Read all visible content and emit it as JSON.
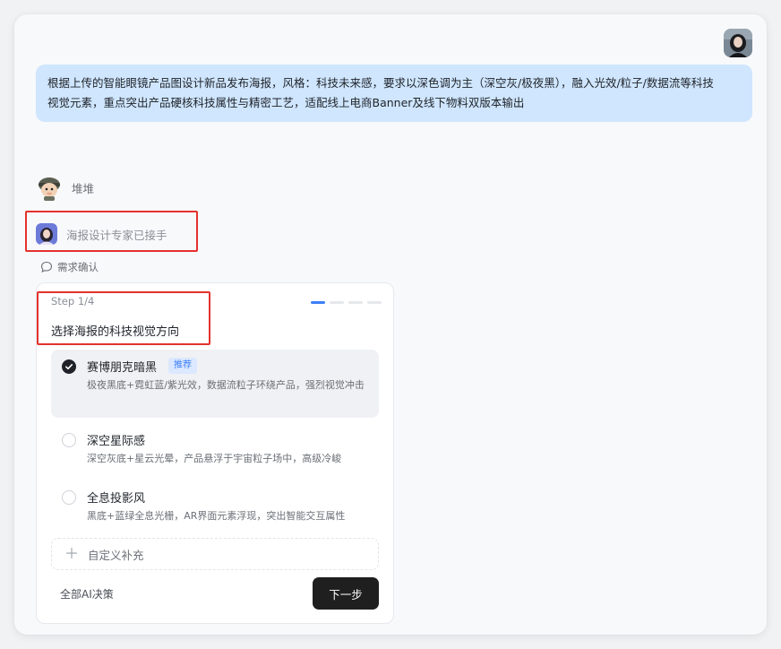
{
  "user_message": {
    "line1": "根据上传的智能眼镜产品图设计新品发布海报，风格：科技未来感，要求以深色调为主（深空灰/极夜黑），融入光效/粒子/数据流等科技",
    "line2": "视觉元素，重点突出产品硬核科技属性与精密工艺，适配线上电商Banner及线下物料双版本输出"
  },
  "bot": {
    "name": "堆堆"
  },
  "handoff": {
    "text": "海报设计专家已接手"
  },
  "requirement": {
    "label": "需求确认"
  },
  "card": {
    "step": "Step 1/4",
    "progress_current": 1,
    "progress_total": 4,
    "title": "选择海报的科技视觉方向",
    "options": [
      {
        "name": "赛博朋克暗黑",
        "badge": "推荐",
        "desc": "极夜黑底+霓虹蓝/紫光效，数据流粒子环绕产品，强烈视觉冲击",
        "selected": true
      },
      {
        "name": "深空星际感",
        "desc": "深空灰底+星云光晕，产品悬浮于宇宙粒子场中，高级冷峻",
        "selected": false
      },
      {
        "name": "全息投影风",
        "desc": "黑底+蓝绿全息光栅，AR界面元素浮现，突出智能交互属性",
        "selected": false
      }
    ],
    "custom_label": "自定义补充",
    "ai_decide": "全部AI决策",
    "next": "下一步"
  },
  "icons": {
    "user_avatar": "user-avatar",
    "bot_avatar": "bot-avatar",
    "expert_avatar": "expert-avatar",
    "chat": "chat-bubble-icon",
    "check": "check-icon",
    "plus": "plus-icon"
  },
  "colors": {
    "user_bubble": "#cfe6fe",
    "accent": "#3d7ff6",
    "highlight": "#e5322d",
    "primary_button": "#1f1f1f"
  }
}
